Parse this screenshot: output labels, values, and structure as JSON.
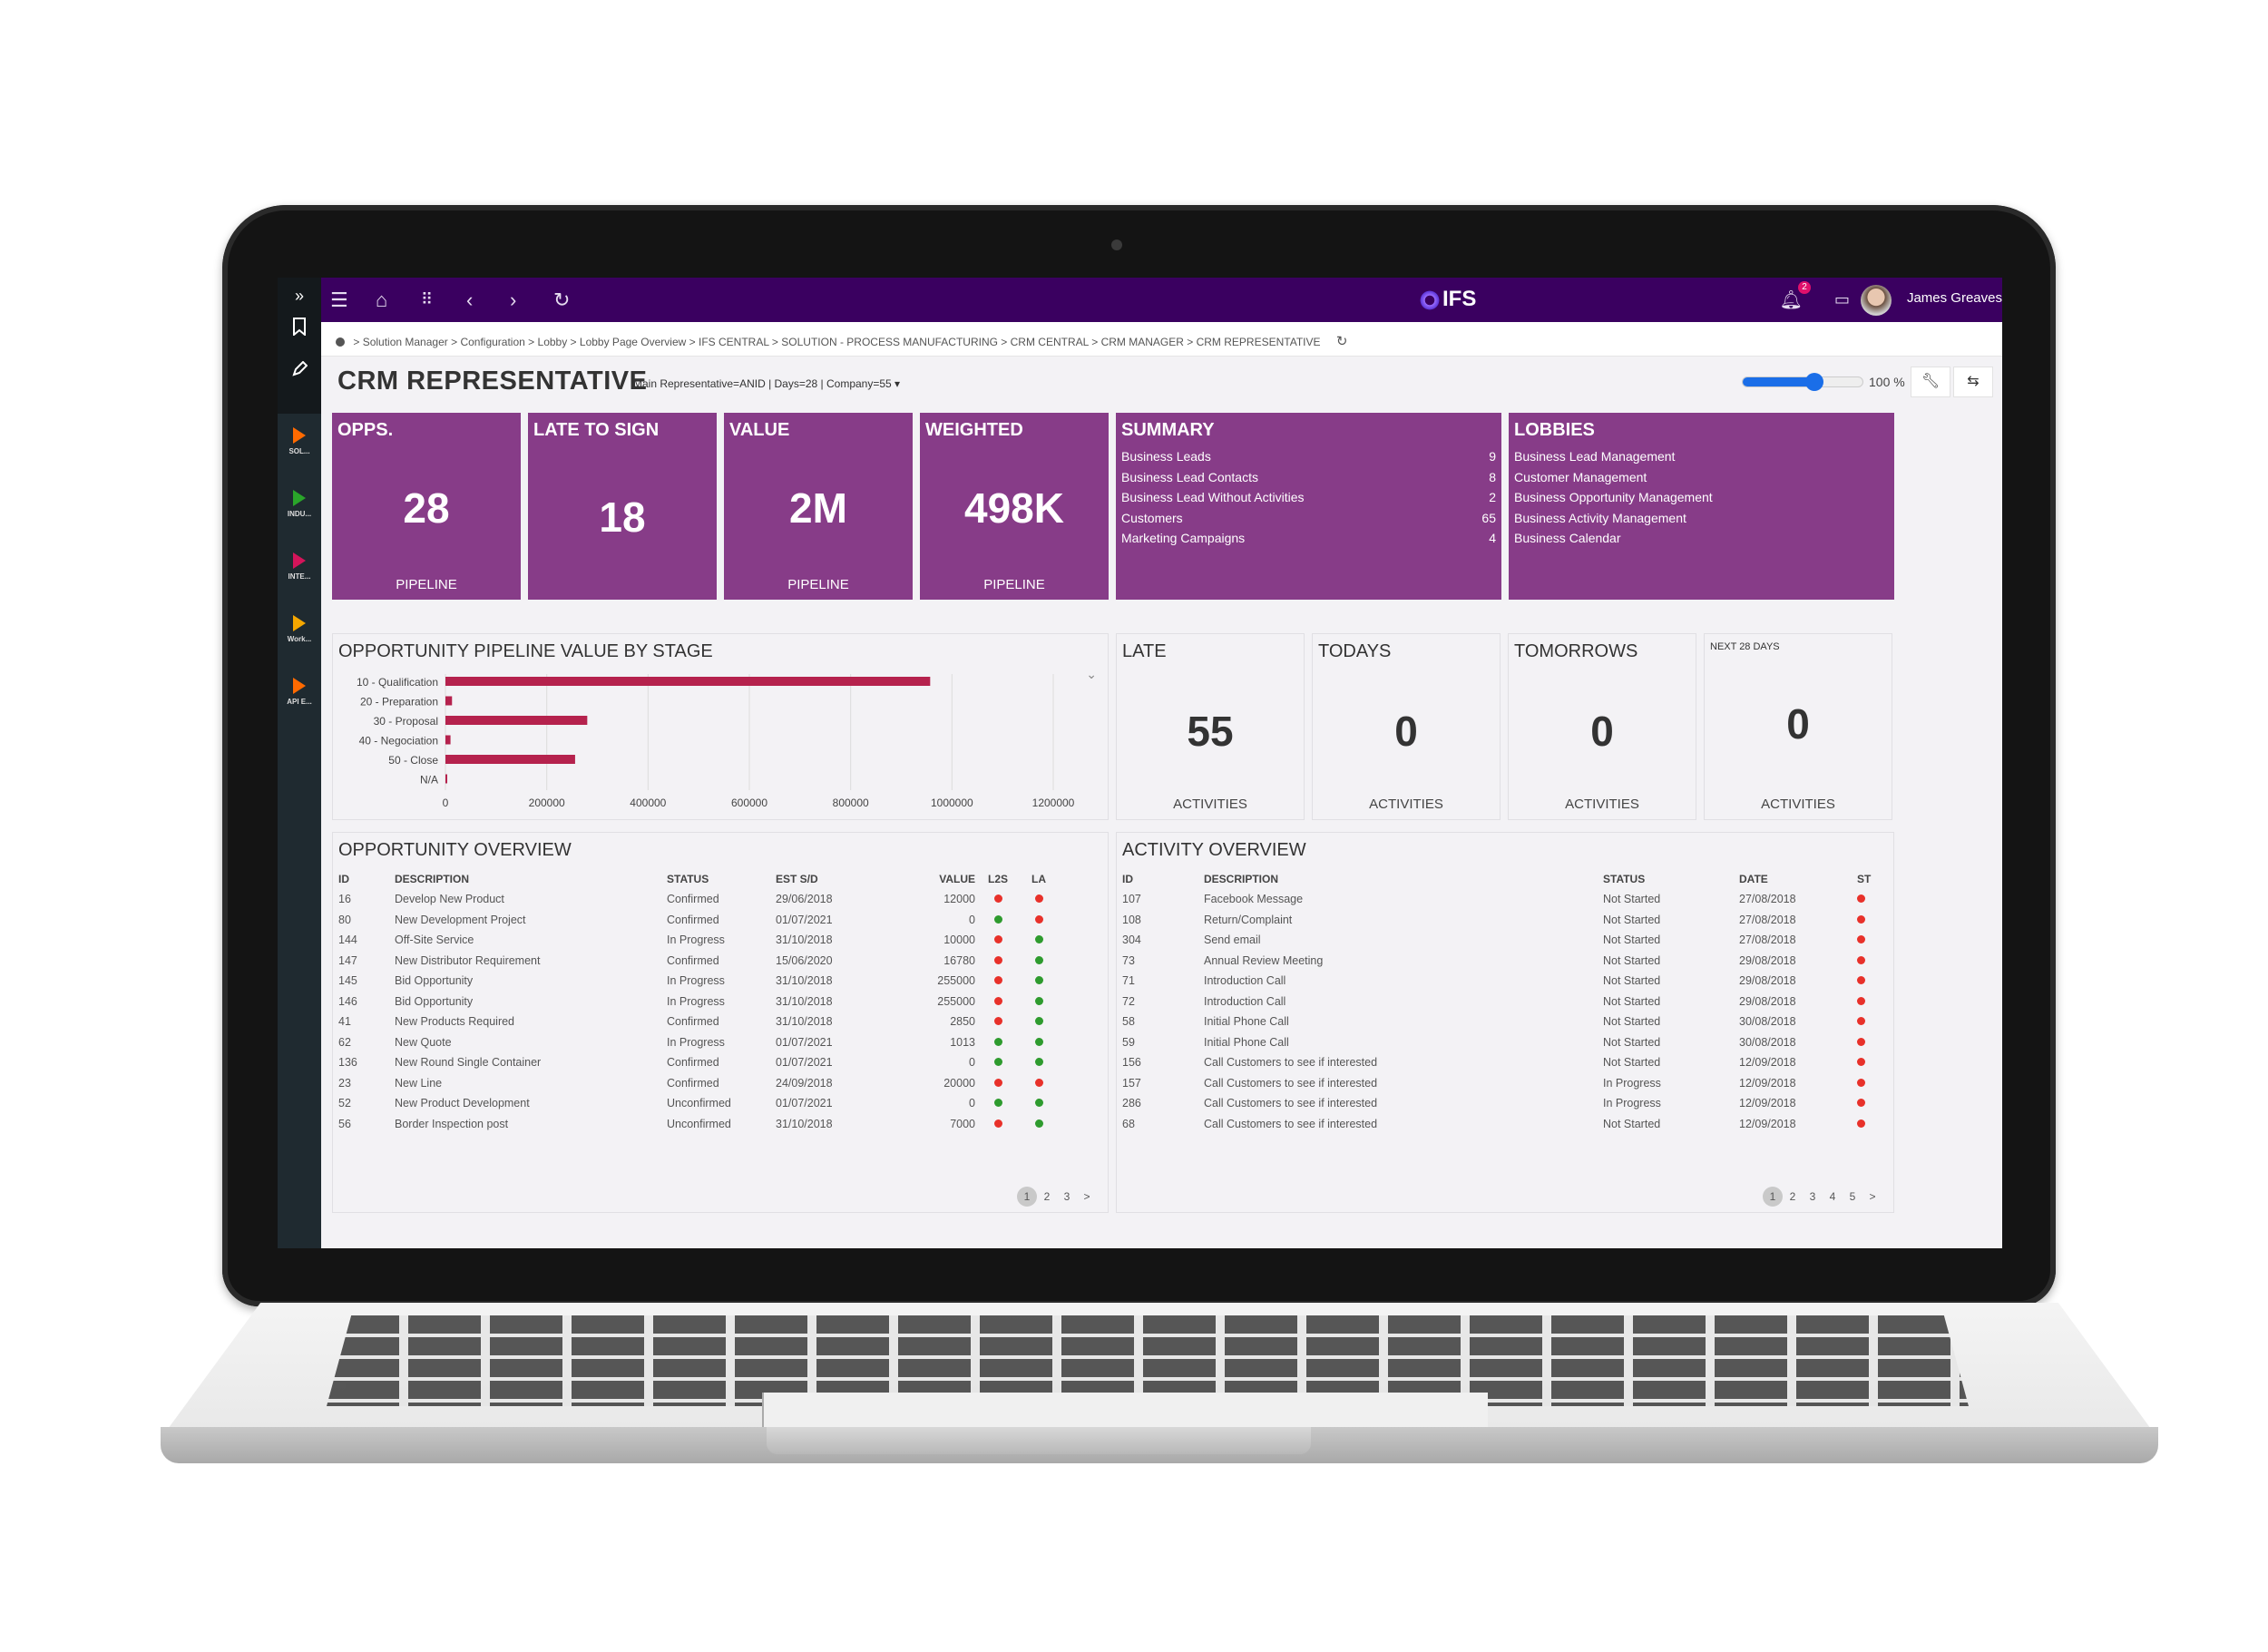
{
  "topbar": {
    "logo_text": "IFS",
    "user_name": "James Greaves",
    "notification_count": "2",
    "nav_icons": [
      "menu-icon",
      "home-icon",
      "apps-grid-icon",
      "back-icon",
      "forward-icon",
      "refresh-icon"
    ]
  },
  "leftbar": {
    "expand_glyph": "»",
    "items": [
      {
        "label": "SOL...",
        "color": "#ff6a00"
      },
      {
        "label": "INDU...",
        "color": "#2aa52a"
      },
      {
        "label": "INTE...",
        "color": "#d4145a"
      },
      {
        "label": "Work...",
        "color": "#f5a700"
      },
      {
        "label": "API E...",
        "color": "#ff6a00"
      }
    ]
  },
  "breadcrumb": {
    "items": [
      "Solution Manager",
      "Configuration",
      "Lobby",
      "Lobby Page Overview",
      "IFS CENTRAL",
      "SOLUTION - PROCESS MANUFACTURING",
      "CRM CENTRAL",
      "CRM MANAGER",
      "CRM REPRESENTATIVE"
    ],
    "separator": " > "
  },
  "page": {
    "title": "CRM REPRESENTATIVE",
    "params": "Main Representative=ANID | Days=28 | Company=55 ▾",
    "zoom_label": "100 %",
    "zoom_slider_fraction": 0.6
  },
  "kpi_tiles": [
    {
      "title": "OPPS.",
      "value": "28",
      "sub": "PIPELINE"
    },
    {
      "title": "LATE TO SIGN",
      "value": "18",
      "sub": ""
    },
    {
      "title": "VALUE",
      "value": "2M",
      "sub": "PIPELINE"
    },
    {
      "title": "WEIGHTED",
      "value": "498K",
      "sub": "PIPELINE"
    }
  ],
  "summary": {
    "title": "SUMMARY",
    "rows": [
      {
        "label": "Business Leads",
        "count": "9"
      },
      {
        "label": "Business Lead Contacts",
        "count": "8"
      },
      {
        "label": "Business Lead Without Activities",
        "count": "2"
      },
      {
        "label": "Customers",
        "count": "65"
      },
      {
        "label": "Marketing Campaigns",
        "count": "4"
      }
    ]
  },
  "lobbies": {
    "title": "LOBBIES",
    "links": [
      "Business Lead Management",
      "Customer Management",
      "Business Opportunity Management",
      "Business Activity Management",
      "Business Calendar"
    ]
  },
  "chart_data": {
    "type": "bar",
    "orientation": "horizontal",
    "title": "OPPORTUNITY PIPELINE VALUE BY STAGE",
    "categories": [
      "10 - Qualification",
      "20 - Preparation",
      "30 - Proposal",
      "40 - Negociation",
      "50 - Close",
      "N/A"
    ],
    "values": [
      957000,
      13000,
      280000,
      10000,
      256000,
      3000
    ],
    "xlim": [
      0,
      1200000
    ],
    "xticks": [
      0,
      200000,
      400000,
      600000,
      800000,
      1000000,
      1200000
    ],
    "grid": true,
    "bar_color": "#b5224d",
    "xlabel": "",
    "ylabel": ""
  },
  "activity_tiles": [
    {
      "title": "LATE",
      "value": "55",
      "sub": "ACTIVITIES"
    },
    {
      "title": "TODAYS",
      "value": "0",
      "sub": "ACTIVITIES"
    },
    {
      "title": "TOMORROWS",
      "value": "0",
      "sub": "ACTIVITIES"
    },
    {
      "title": "NEXT 28 DAYS",
      "value": "0",
      "sub": "ACTIVITIES"
    }
  ],
  "opportunity_overview": {
    "title": "OPPORTUNITY OVERVIEW",
    "columns": [
      "ID",
      "DESCRIPTION",
      "STATUS",
      "EST S/D",
      "VALUE",
      "L2S",
      "LA"
    ],
    "rows": [
      {
        "id": "16",
        "desc": "Develop New Product",
        "status": "Confirmed",
        "date": "29/06/2018",
        "value": "12000",
        "l2s": "red",
        "la": "red"
      },
      {
        "id": "80",
        "desc": "New Development Project",
        "status": "Confirmed",
        "date": "01/07/2021",
        "value": "0",
        "l2s": "green",
        "la": "red"
      },
      {
        "id": "144",
        "desc": "Off-Site Service",
        "status": "In Progress",
        "date": "31/10/2018",
        "value": "10000",
        "l2s": "red",
        "la": "green"
      },
      {
        "id": "147",
        "desc": "New Distributor Requirement",
        "status": "Confirmed",
        "date": "15/06/2020",
        "value": "16780",
        "l2s": "red",
        "la": "green"
      },
      {
        "id": "145",
        "desc": "Bid Opportunity",
        "status": "In Progress",
        "date": "31/10/2018",
        "value": "255000",
        "l2s": "red",
        "la": "green"
      },
      {
        "id": "146",
        "desc": "Bid Opportunity",
        "status": "In Progress",
        "date": "31/10/2018",
        "value": "255000",
        "l2s": "red",
        "la": "green"
      },
      {
        "id": "41",
        "desc": "New Products Required",
        "status": "Confirmed",
        "date": "31/10/2018",
        "value": "2850",
        "l2s": "red",
        "la": "green"
      },
      {
        "id": "62",
        "desc": "New Quote",
        "status": "In Progress",
        "date": "01/07/2021",
        "value": "1013",
        "l2s": "green",
        "la": "green"
      },
      {
        "id": "136",
        "desc": "New Round Single Container",
        "status": "Confirmed",
        "date": "01/07/2021",
        "value": "0",
        "l2s": "green",
        "la": "green"
      },
      {
        "id": "23",
        "desc": "New Line",
        "status": "Confirmed",
        "date": "24/09/2018",
        "value": "20000",
        "l2s": "red",
        "la": "red"
      },
      {
        "id": "52",
        "desc": "New Product Development",
        "status": "Unconfirmed",
        "date": "01/07/2021",
        "value": "0",
        "l2s": "green",
        "la": "green"
      },
      {
        "id": "56",
        "desc": "Border Inspection post",
        "status": "Unconfirmed",
        "date": "31/10/2018",
        "value": "7000",
        "l2s": "red",
        "la": "green"
      }
    ],
    "pages": [
      "1",
      "2",
      "3"
    ],
    "current_page": "1",
    "next_glyph": ">"
  },
  "activity_overview": {
    "title": "ACTIVITY OVERVIEW",
    "columns": [
      "ID",
      "DESCRIPTION",
      "STATUS",
      "DATE",
      "ST"
    ],
    "rows": [
      {
        "id": "107",
        "desc": "Facebook Message",
        "status": "Not Started",
        "date": "27/08/2018",
        "st": "red"
      },
      {
        "id": "108",
        "desc": "Return/Complaint",
        "status": "Not Started",
        "date": "27/08/2018",
        "st": "red"
      },
      {
        "id": "304",
        "desc": "Send email",
        "status": "Not Started",
        "date": "27/08/2018",
        "st": "red"
      },
      {
        "id": "73",
        "desc": "Annual Review Meeting",
        "status": "Not Started",
        "date": "29/08/2018",
        "st": "red"
      },
      {
        "id": "71",
        "desc": "Introduction Call",
        "status": "Not Started",
        "date": "29/08/2018",
        "st": "red"
      },
      {
        "id": "72",
        "desc": "Introduction Call",
        "status": "Not Started",
        "date": "29/08/2018",
        "st": "red"
      },
      {
        "id": "58",
        "desc": "Initial Phone Call",
        "status": "Not Started",
        "date": "30/08/2018",
        "st": "red"
      },
      {
        "id": "59",
        "desc": "Initial Phone Call",
        "status": "Not Started",
        "date": "30/08/2018",
        "st": "red"
      },
      {
        "id": "156",
        "desc": "Call Customers to see if interested",
        "status": "Not Started",
        "date": "12/09/2018",
        "st": "red"
      },
      {
        "id": "157",
        "desc": "Call Customers to see if interested",
        "status": "In Progress",
        "date": "12/09/2018",
        "st": "red"
      },
      {
        "id": "286",
        "desc": "Call Customers to see if interested",
        "status": "In Progress",
        "date": "12/09/2018",
        "st": "red"
      },
      {
        "id": "68",
        "desc": "Call Customers to see if interested",
        "status": "Not Started",
        "date": "12/09/2018",
        "st": "red"
      }
    ],
    "pages": [
      "1",
      "2",
      "3",
      "4",
      "5"
    ],
    "current_page": "1",
    "next_glyph": ">"
  },
  "colors": {
    "topbar": "#3a0060",
    "tile_purple": "#873c88",
    "status_red": "#e8312a",
    "status_green": "#2e9b2e",
    "accent_blue": "#1a6ee8"
  }
}
